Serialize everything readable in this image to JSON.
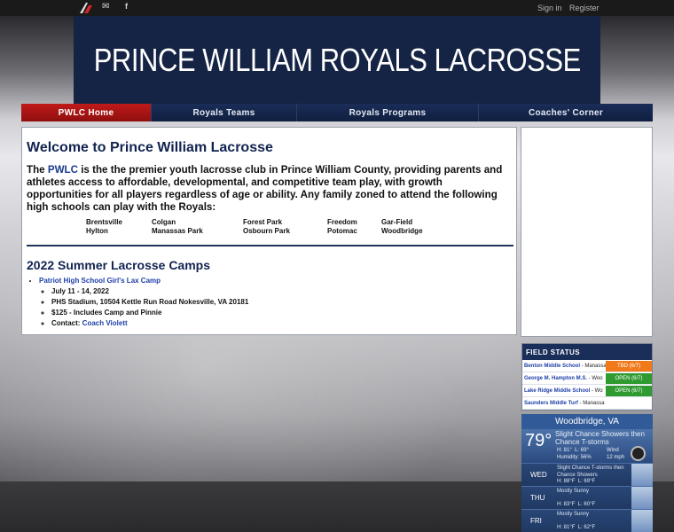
{
  "topbar": {
    "sign_in": "Sign in",
    "register": "Register"
  },
  "banner": {
    "title": "PRINCE WILLIAM ROYALS LACROSSE"
  },
  "nav": {
    "items": [
      {
        "label": "PWLC Home",
        "active": true
      },
      {
        "label": "Royals Teams"
      },
      {
        "label": "Royals Programs"
      },
      {
        "label": "Coaches' Corner"
      }
    ]
  },
  "main": {
    "heading": "Welcome to Prince William Lacrosse",
    "intro_prefix": "The ",
    "intro_brand": "PWLC",
    "intro_body": " is the the premier youth lacrosse club in Prince William County, providing parents and athletes access to affordable, developmental, and competitive team play, with growth opportunities for all players regardless of age or ability.  Any family zoned to attend the following high schools can play with the Royals:",
    "schools": [
      "Brentsville",
      "Colgan",
      "Forest Park",
      "Freedom",
      "Gar-Field",
      "Hylton",
      "Manassas Park",
      "Osbourn Park",
      "Potomac",
      "Woodbridge"
    ],
    "camps_heading": "2022 Summer Lacrosse Camps",
    "camp": {
      "name": "Patriot High School Girl's Lax Camp",
      "dates": "July 11 - 14, 2022",
      "location": "PHS Stadium, 10504 Kettle Run Road Nokesville, VA 20181",
      "price": "$125 - Includes Camp and Pinnie",
      "contact_label": "Contact: ",
      "contact_name": "Coach Violett"
    }
  },
  "field_status": {
    "title": "FIELD STATUS",
    "rows": [
      {
        "name": "Benton Middle School",
        "location": " - Manassa",
        "status": "TBD (6/7)",
        "color": "#f07a1a"
      },
      {
        "name": "George M. Hampton M.S.",
        "location": " - Woo",
        "status": "OPEN (6/7)",
        "color": "#2f9a2f"
      },
      {
        "name": "Lake Ridge Middle School",
        "location": " - Wo",
        "status": "OPEN (6/7)",
        "color": "#2f9a2f"
      },
      {
        "name": "Saunders Middle Turf",
        "location": " - Manassa",
        "status": "",
        "color": "#ffffff"
      }
    ]
  },
  "weather": {
    "city": "Woodbridge, VA",
    "now_temp": "79°",
    "now_desc": "Slight Chance Showers then Chance T-storms",
    "now_hi": "H: 81°",
    "now_lo": "L: 69°",
    "now_humidity": "Humidity: 56%",
    "wind_label": "Wind",
    "wind_value": "12 mph",
    "days": [
      {
        "day": "WED",
        "desc": "Slight Chance T-storms then Chance Showers",
        "hi": "H: 88°F",
        "lo": "L: 69°F"
      },
      {
        "day": "THU",
        "desc": "Mostly Sunny",
        "hi": "H: 83°F",
        "lo": "L: 60°F"
      },
      {
        "day": "FRI",
        "desc": "Mostly Sunny",
        "hi": "H: 81°F",
        "lo": "L: 62°F"
      }
    ]
  }
}
